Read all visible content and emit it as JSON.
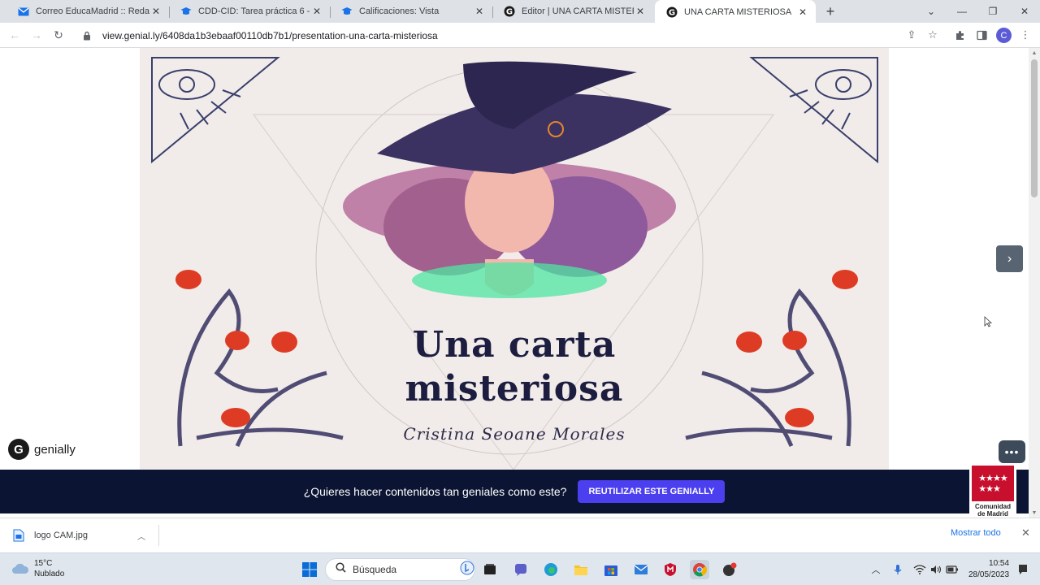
{
  "browser": {
    "tabs": [
      {
        "title": "Correo EducaMadrid :: Redactar",
        "favicon": "mail-icon"
      },
      {
        "title": "CDD-CID: Tarea práctica 6 - Nive",
        "favicon": "graduation-cap-icon"
      },
      {
        "title": "Calificaciones: Vista",
        "favicon": "graduation-cap-icon"
      },
      {
        "title": "Editor | UNA CARTA MISTERIOSA",
        "favicon": "genially-icon"
      },
      {
        "title": "UNA CARTA MISTERIOSA",
        "favicon": "genially-icon"
      }
    ],
    "active_tab": 4,
    "url": "view.genial.ly/6408da1b3ebaaf00110db7b1/presentation-una-carta-misteriosa",
    "profile_initial": "C"
  },
  "slide": {
    "title_line1": "Una carta",
    "title_line2": "misteriosa",
    "author": "Cristina Seoane Morales"
  },
  "genially": {
    "brand": "genially",
    "banner_text": "¿Quieres hacer contenidos tan geniales como este?",
    "banner_button": "REUTILIZAR ESTE GENIALLY",
    "more_button": "•••"
  },
  "cam_logo": {
    "line1": "Comunidad",
    "line2": "de Madrid"
  },
  "download_bar": {
    "file_name": "logo CAM.jpg",
    "show_all": "Mostrar todo"
  },
  "taskbar": {
    "temperature": "15°C",
    "weather": "Nublado",
    "search_placeholder": "Búsqueda",
    "time": "10:54",
    "date": "28/05/2023"
  },
  "colors": {
    "banner_bg": "#0b1533",
    "banner_button": "#4b3ff0",
    "slide_bg": "#f1ecea",
    "title_color": "#1c1d3f"
  }
}
